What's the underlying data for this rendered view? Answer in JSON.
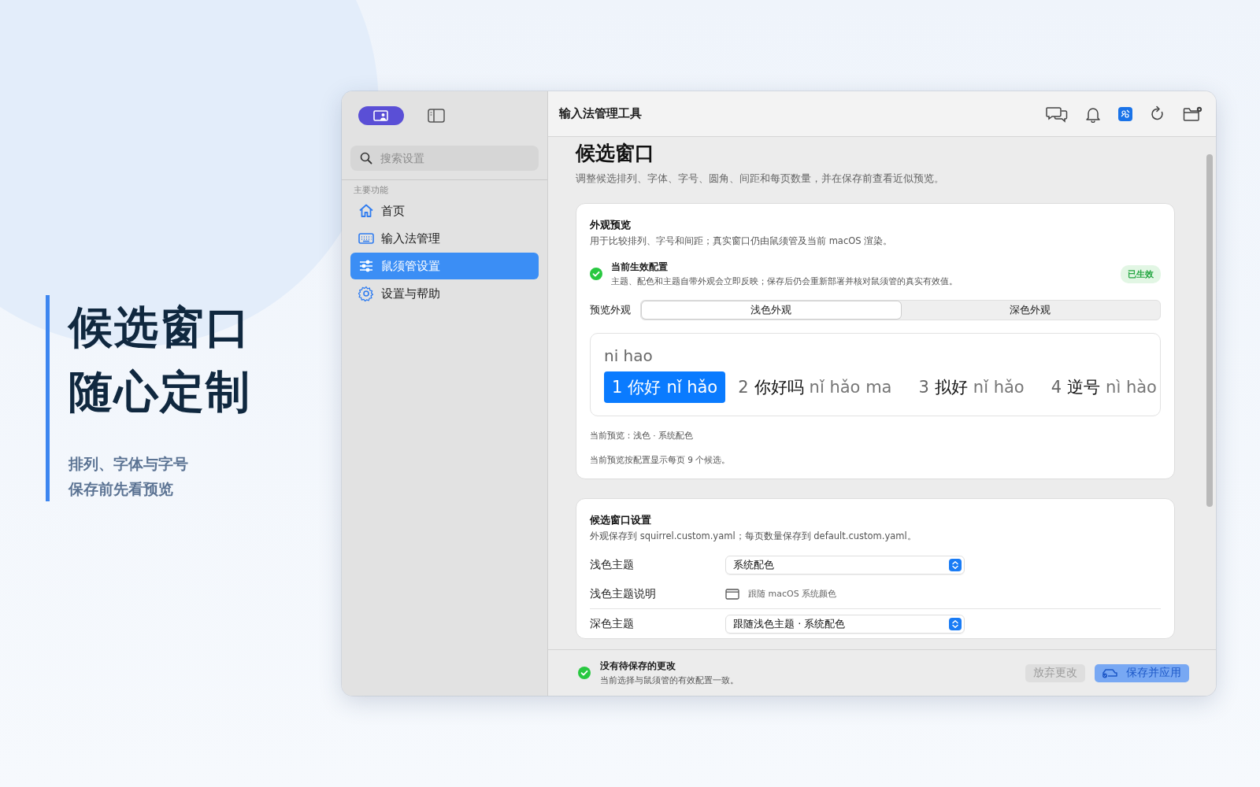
{
  "hero": {
    "title_lines": [
      "候选窗口",
      "随心定制"
    ],
    "subtitle_lines": [
      "排列、字体与字号",
      "保存前先看预览"
    ]
  },
  "window": {
    "title": "输入法管理工具"
  },
  "sidebar": {
    "search": {
      "placeholder": "搜索设置"
    },
    "section": "主要功能",
    "items": [
      {
        "label": "首页",
        "selected": false
      },
      {
        "label": "输入法管理",
        "selected": false
      },
      {
        "label": "鼠须管设置",
        "selected": true
      },
      {
        "label": "设置与帮助",
        "selected": false
      }
    ]
  },
  "page": {
    "title": "候选窗口",
    "subtitle": "调整候选排列、字体、字号、圆角、间距和每页数量，并在保存前查看近似预览。"
  },
  "preview_card": {
    "title": "外观预览",
    "description": "用于比较排列、字号和间距；真实窗口仍由鼠须管及当前 macOS 渲染。",
    "status": {
      "title": "当前生效配置",
      "description": "主题、配色和主题自带外观会立即反映；保存后仍会重新部署并核对鼠须管的真实有效值。",
      "badge": "已生效"
    },
    "appearance": {
      "label": "预览外观",
      "options": [
        {
          "label": "浅色外观",
          "selected": true
        },
        {
          "label": "深色外观",
          "selected": false
        }
      ]
    },
    "preview": {
      "input": "ni hao",
      "candidates": [
        {
          "index": "1",
          "word": "你好",
          "pinyin": "nǐ hǎo",
          "selected": true
        },
        {
          "index": "2",
          "word": "你好吗",
          "pinyin": "nǐ hǎo ma",
          "selected": false
        },
        {
          "index": "3",
          "word": "拟好",
          "pinyin": "nǐ hǎo",
          "selected": false
        },
        {
          "index": "4",
          "word": "逆号",
          "pinyin": "nì hào",
          "selected": false
        }
      ]
    },
    "notes": [
      "当前预览：浅色 · 系统配色",
      "当前预览按配置显示每页 9 个候选。"
    ]
  },
  "settings_card": {
    "title": "候选窗口设置",
    "description": "外观保存到 squirrel.custom.yaml；每页数量保存到 default.custom.yaml。",
    "rows": [
      {
        "kind": "select",
        "label": "浅色主题",
        "value": "系统配色"
      },
      {
        "kind": "info",
        "label": "浅色主题说明",
        "value": "跟随 macOS 系统颜色"
      },
      {
        "kind": "select",
        "label": "深色主题",
        "value": "跟随浅色主题 · 系统配色"
      }
    ]
  },
  "footer": {
    "status": {
      "title": "没有待保存的更改",
      "description": "当前选择与鼠须管的有效配置一致。"
    },
    "buttons": [
      {
        "label": "放弃更改",
        "kind": "secondary",
        "disabled": true
      },
      {
        "label": "保存并应用",
        "kind": "primary",
        "disabled": true
      }
    ]
  }
}
